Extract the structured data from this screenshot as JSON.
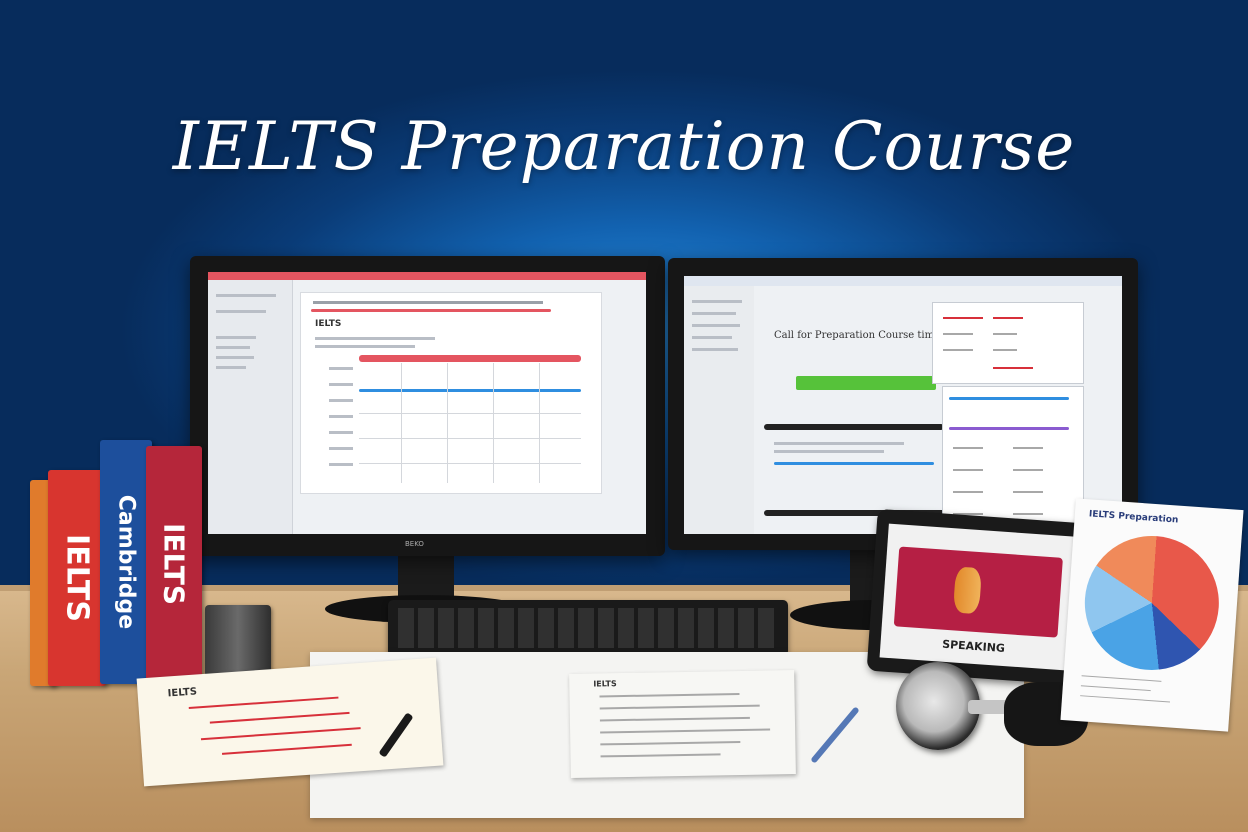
{
  "headline": "IELTS Preparation Course",
  "left_monitor": {
    "panel_title": "IELTS",
    "brand": "BEKO"
  },
  "right_monitor": {
    "heading": "Call for Preparation Course time"
  },
  "books": [
    {
      "spine": "IELTS",
      "color": "#d8352f"
    },
    {
      "spine": "Cambridge",
      "color": "#1d4f9c"
    },
    {
      "spine": "IELTS",
      "color": "#b5263a"
    }
  ],
  "notepad": {
    "label": "IELTS"
  },
  "worksheet": {
    "label": "IELTS"
  },
  "tablet": {
    "caption": "SPEAKING"
  },
  "flyer": {
    "header": "IELTS Preparation"
  },
  "colors": {
    "background": "#0b3f78",
    "accent_red": "#d7303a",
    "accent_blue": "#2f8ee0",
    "accent_green": "#56c23a"
  }
}
